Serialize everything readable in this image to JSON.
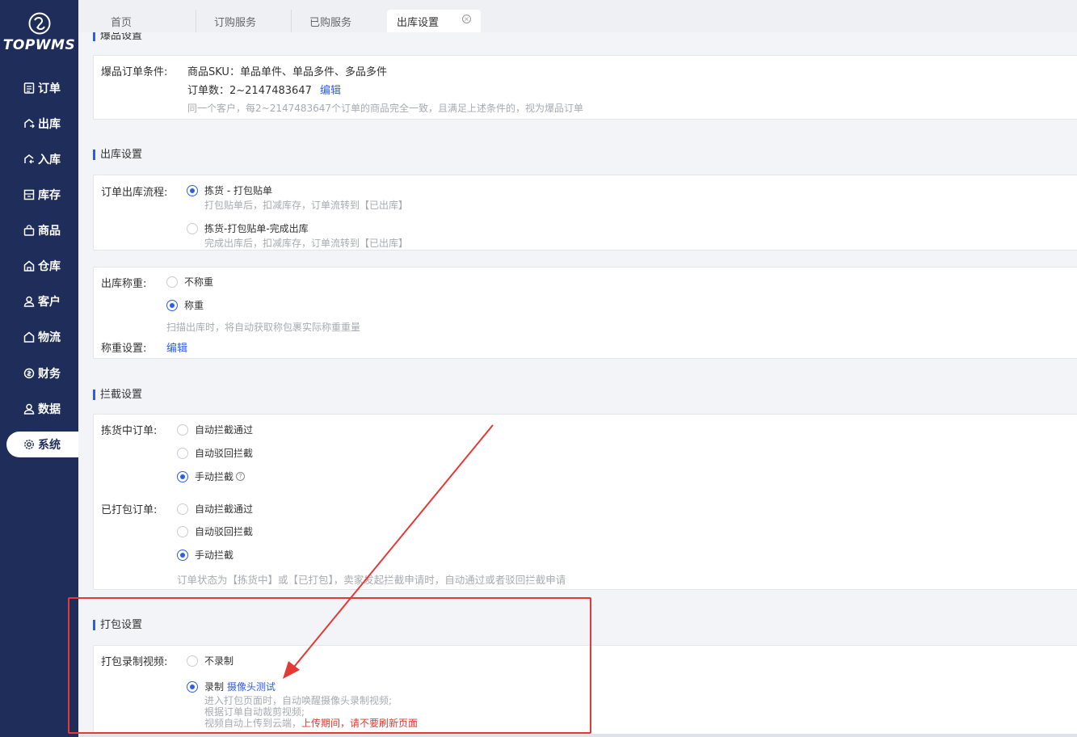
{
  "app": {
    "logo_text": "TOPWMS"
  },
  "sidebar": {
    "items": [
      {
        "label": "订单",
        "icon": "order-icon"
      },
      {
        "label": "出库",
        "icon": "outbound-icon"
      },
      {
        "label": "入库",
        "icon": "inbound-icon"
      },
      {
        "label": "库存",
        "icon": "inventory-icon"
      },
      {
        "label": "商品",
        "icon": "goods-icon"
      },
      {
        "label": "仓库",
        "icon": "warehouse-icon"
      },
      {
        "label": "客户",
        "icon": "customer-icon"
      },
      {
        "label": "物流",
        "icon": "logistics-icon"
      },
      {
        "label": "财务",
        "icon": "finance-icon"
      },
      {
        "label": "数据",
        "icon": "data-icon"
      },
      {
        "label": "系统",
        "icon": "gear-icon",
        "active": true
      }
    ]
  },
  "tabs": [
    {
      "label": "首页"
    },
    {
      "label": "订购服务"
    },
    {
      "label": "已购服务"
    },
    {
      "label": "出库设置",
      "active": true
    }
  ],
  "hot_section": {
    "title": "爆品设置",
    "label": "爆品订单条件:",
    "sku_line": "商品SKU：单品单件、单品多件、多品多件",
    "count_line": "订单数：2~2147483647",
    "edit": "编辑",
    "hint": "同一个客户，每2~2147483647个订单的商品完全一致，且满足上述条件的，视为爆品订单"
  },
  "outbound_section": {
    "title": "出库设置",
    "flow_label": "订单出库流程:",
    "flow_options": [
      {
        "label": "拣货 - 打包贴单",
        "hint": "打包贴单后，扣减库存，订单流转到【已出库】",
        "selected": true
      },
      {
        "label": "拣货-打包贴单-完成出库",
        "hint": "完成出库后，扣减库存，订单流转到【已出库】",
        "selected": false
      }
    ],
    "weigh_label": "出库称重:",
    "weigh_options": [
      {
        "label": "不称重",
        "selected": false
      },
      {
        "label": "称重",
        "selected": true
      }
    ],
    "weigh_hint": "扫描出库时，将自动获取称包裹实际称重重量",
    "weigh_setting_label": "称重设置:",
    "weigh_setting_edit": "编辑"
  },
  "intercept_section": {
    "title": "拦截设置",
    "picking_label": "拣货中订单:",
    "picking_options": [
      {
        "label": "自动拦截通过",
        "selected": false
      },
      {
        "label": "自动驳回拦截",
        "selected": false
      },
      {
        "label": "手动拦截",
        "selected": true,
        "help": "?"
      }
    ],
    "packed_label": "已打包订单:",
    "packed_options": [
      {
        "label": "自动拦截通过",
        "selected": false
      },
      {
        "label": "自动驳回拦截",
        "selected": false
      },
      {
        "label": "手动拦截",
        "selected": true
      }
    ],
    "hint": "订单状态为【拣货中】或【已打包】，卖家发起拦截申请时，自动通过或者驳回拦截申请"
  },
  "pack_section": {
    "title": "打包设置",
    "video_label": "打包录制视频:",
    "options": [
      {
        "label": "不录制",
        "selected": false
      },
      {
        "label": "录制",
        "selected": true,
        "link": "摄像头测试"
      }
    ],
    "hints": [
      "进入打包页面时，自动唤醒摄像头录制视频;",
      "根据订单自动裁剪视频;",
      "视频自动上传到云端，"
    ],
    "warning": "上传期间，请不要刷新页面"
  },
  "colors": {
    "sidebar": "#1f2d5a",
    "accent": "#2f5fe0",
    "annotation": "#e53935"
  }
}
